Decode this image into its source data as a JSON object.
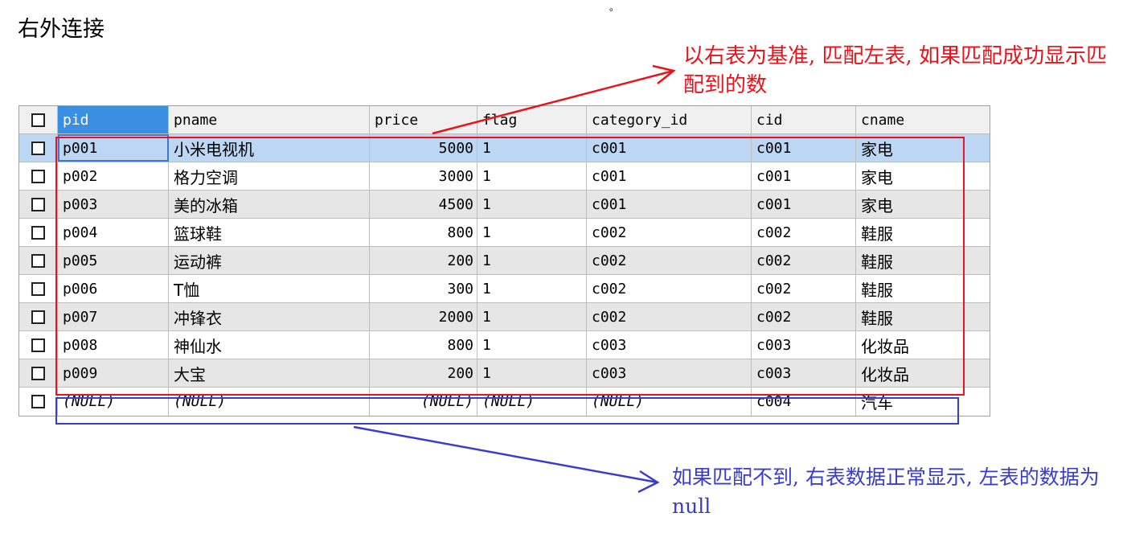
{
  "page": {
    "title": "右外连接",
    "top_mark": "。"
  },
  "annotations": {
    "red_text": "以右表为基准, 匹配左表, 如果匹配成功显示匹配到的数",
    "blue_text": "如果匹配不到, 右表数据正常显示, 左表的数据为null"
  },
  "grid": {
    "columns": [
      "pid",
      "pname",
      "price",
      "flag",
      "category_id",
      "cid",
      "cname"
    ],
    "rows": [
      [
        "p001",
        "小米电视机",
        "5000",
        "1",
        "c001",
        "c001",
        "家电"
      ],
      [
        "p002",
        "格力空调",
        "3000",
        "1",
        "c001",
        "c001",
        "家电"
      ],
      [
        "p003",
        "美的冰箱",
        "4500",
        "1",
        "c001",
        "c001",
        "家电"
      ],
      [
        "p004",
        "篮球鞋",
        "800",
        "1",
        "c002",
        "c002",
        "鞋服"
      ],
      [
        "p005",
        "运动裤",
        "200",
        "1",
        "c002",
        "c002",
        "鞋服"
      ],
      [
        "p006",
        "T恤",
        "300",
        "1",
        "c002",
        "c002",
        "鞋服"
      ],
      [
        "p007",
        "冲锋衣",
        "2000",
        "1",
        "c002",
        "c002",
        "鞋服"
      ],
      [
        "p008",
        "神仙水",
        "800",
        "1",
        "c003",
        "c003",
        "化妆品"
      ],
      [
        "p009",
        "大宝",
        "200",
        "1",
        "c003",
        "c003",
        "化妆品"
      ],
      [
        "(NULL)",
        "(NULL)",
        "(NULL)",
        "(NULL)",
        "(NULL)",
        "c004",
        "汽车"
      ]
    ]
  },
  "colors": {
    "red_annotation": "#e8141c",
    "blue_annotation": "#3a3ccc",
    "selected_row": "#bcd6f3",
    "active_header": "#3a8fe0"
  }
}
